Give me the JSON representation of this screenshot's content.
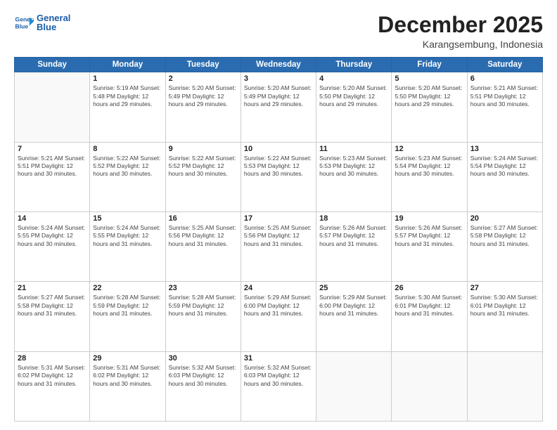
{
  "logo": {
    "line1": "General",
    "line2": "Blue"
  },
  "header": {
    "month": "December 2025",
    "location": "Karangsembung, Indonesia"
  },
  "weekdays": [
    "Sunday",
    "Monday",
    "Tuesday",
    "Wednesday",
    "Thursday",
    "Friday",
    "Saturday"
  ],
  "weeks": [
    [
      {
        "day": "",
        "info": ""
      },
      {
        "day": "1",
        "info": "Sunrise: 5:19 AM\nSunset: 5:48 PM\nDaylight: 12 hours\nand 29 minutes."
      },
      {
        "day": "2",
        "info": "Sunrise: 5:20 AM\nSunset: 5:49 PM\nDaylight: 12 hours\nand 29 minutes."
      },
      {
        "day": "3",
        "info": "Sunrise: 5:20 AM\nSunset: 5:49 PM\nDaylight: 12 hours\nand 29 minutes."
      },
      {
        "day": "4",
        "info": "Sunrise: 5:20 AM\nSunset: 5:50 PM\nDaylight: 12 hours\nand 29 minutes."
      },
      {
        "day": "5",
        "info": "Sunrise: 5:20 AM\nSunset: 5:50 PM\nDaylight: 12 hours\nand 29 minutes."
      },
      {
        "day": "6",
        "info": "Sunrise: 5:21 AM\nSunset: 5:51 PM\nDaylight: 12 hours\nand 30 minutes."
      }
    ],
    [
      {
        "day": "7",
        "info": "Sunrise: 5:21 AM\nSunset: 5:51 PM\nDaylight: 12 hours\nand 30 minutes."
      },
      {
        "day": "8",
        "info": "Sunrise: 5:22 AM\nSunset: 5:52 PM\nDaylight: 12 hours\nand 30 minutes."
      },
      {
        "day": "9",
        "info": "Sunrise: 5:22 AM\nSunset: 5:52 PM\nDaylight: 12 hours\nand 30 minutes."
      },
      {
        "day": "10",
        "info": "Sunrise: 5:22 AM\nSunset: 5:53 PM\nDaylight: 12 hours\nand 30 minutes."
      },
      {
        "day": "11",
        "info": "Sunrise: 5:23 AM\nSunset: 5:53 PM\nDaylight: 12 hours\nand 30 minutes."
      },
      {
        "day": "12",
        "info": "Sunrise: 5:23 AM\nSunset: 5:54 PM\nDaylight: 12 hours\nand 30 minutes."
      },
      {
        "day": "13",
        "info": "Sunrise: 5:24 AM\nSunset: 5:54 PM\nDaylight: 12 hours\nand 30 minutes."
      }
    ],
    [
      {
        "day": "14",
        "info": "Sunrise: 5:24 AM\nSunset: 5:55 PM\nDaylight: 12 hours\nand 30 minutes."
      },
      {
        "day": "15",
        "info": "Sunrise: 5:24 AM\nSunset: 5:55 PM\nDaylight: 12 hours\nand 31 minutes."
      },
      {
        "day": "16",
        "info": "Sunrise: 5:25 AM\nSunset: 5:56 PM\nDaylight: 12 hours\nand 31 minutes."
      },
      {
        "day": "17",
        "info": "Sunrise: 5:25 AM\nSunset: 5:56 PM\nDaylight: 12 hours\nand 31 minutes."
      },
      {
        "day": "18",
        "info": "Sunrise: 5:26 AM\nSunset: 5:57 PM\nDaylight: 12 hours\nand 31 minutes."
      },
      {
        "day": "19",
        "info": "Sunrise: 5:26 AM\nSunset: 5:57 PM\nDaylight: 12 hours\nand 31 minutes."
      },
      {
        "day": "20",
        "info": "Sunrise: 5:27 AM\nSunset: 5:58 PM\nDaylight: 12 hours\nand 31 minutes."
      }
    ],
    [
      {
        "day": "21",
        "info": "Sunrise: 5:27 AM\nSunset: 5:58 PM\nDaylight: 12 hours\nand 31 minutes."
      },
      {
        "day": "22",
        "info": "Sunrise: 5:28 AM\nSunset: 5:59 PM\nDaylight: 12 hours\nand 31 minutes."
      },
      {
        "day": "23",
        "info": "Sunrise: 5:28 AM\nSunset: 5:59 PM\nDaylight: 12 hours\nand 31 minutes."
      },
      {
        "day": "24",
        "info": "Sunrise: 5:29 AM\nSunset: 6:00 PM\nDaylight: 12 hours\nand 31 minutes."
      },
      {
        "day": "25",
        "info": "Sunrise: 5:29 AM\nSunset: 6:00 PM\nDaylight: 12 hours\nand 31 minutes."
      },
      {
        "day": "26",
        "info": "Sunrise: 5:30 AM\nSunset: 6:01 PM\nDaylight: 12 hours\nand 31 minutes."
      },
      {
        "day": "27",
        "info": "Sunrise: 5:30 AM\nSunset: 6:01 PM\nDaylight: 12 hours\nand 31 minutes."
      }
    ],
    [
      {
        "day": "28",
        "info": "Sunrise: 5:31 AM\nSunset: 6:02 PM\nDaylight: 12 hours\nand 31 minutes."
      },
      {
        "day": "29",
        "info": "Sunrise: 5:31 AM\nSunset: 6:02 PM\nDaylight: 12 hours\nand 30 minutes."
      },
      {
        "day": "30",
        "info": "Sunrise: 5:32 AM\nSunset: 6:03 PM\nDaylight: 12 hours\nand 30 minutes."
      },
      {
        "day": "31",
        "info": "Sunrise: 5:32 AM\nSunset: 6:03 PM\nDaylight: 12 hours\nand 30 minutes."
      },
      {
        "day": "",
        "info": ""
      },
      {
        "day": "",
        "info": ""
      },
      {
        "day": "",
        "info": ""
      }
    ]
  ]
}
